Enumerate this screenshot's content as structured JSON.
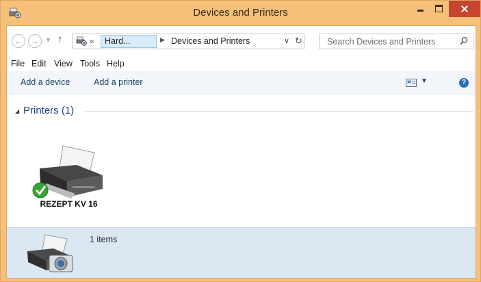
{
  "window": {
    "title": "Devices and Printers",
    "accent_color": "#f4c07a",
    "close_color": "#c7452f"
  },
  "navigation": {
    "back_icon": "arrow-left-icon",
    "forward_icon": "arrow-right-icon",
    "recent_icon": "chevron-down-icon",
    "up_icon": "arrow-up-icon",
    "up_glyph": "↑",
    "back_glyph": "←",
    "forward_glyph": "→",
    "recent_glyph": "▼"
  },
  "address_bar": {
    "overflow_glyph": "«",
    "crumbs": [
      {
        "label": "Hard..."
      },
      {
        "label": "Devices and Printers"
      }
    ],
    "separator_glyph": "▶",
    "dropdown_glyph": "∨",
    "refresh_glyph": "↻"
  },
  "search": {
    "placeholder": "Search Devices and Printers"
  },
  "menu": {
    "items": [
      "File",
      "Edit",
      "View",
      "Tools",
      "Help"
    ]
  },
  "command_bar": {
    "add_device": "Add a device",
    "add_printer": "Add a printer",
    "view_dropdown_glyph": "▼",
    "help_glyph": "?"
  },
  "content": {
    "groups": [
      {
        "title": "Printers (1)",
        "caret_glyph": "◢",
        "devices": [
          {
            "name": "REZEPT KV 16",
            "status": "default-printer",
            "icon": "printer-icon"
          }
        ]
      }
    ]
  },
  "details_pane": {
    "count_text": "1 items",
    "icon": "printer-camera-icon"
  }
}
